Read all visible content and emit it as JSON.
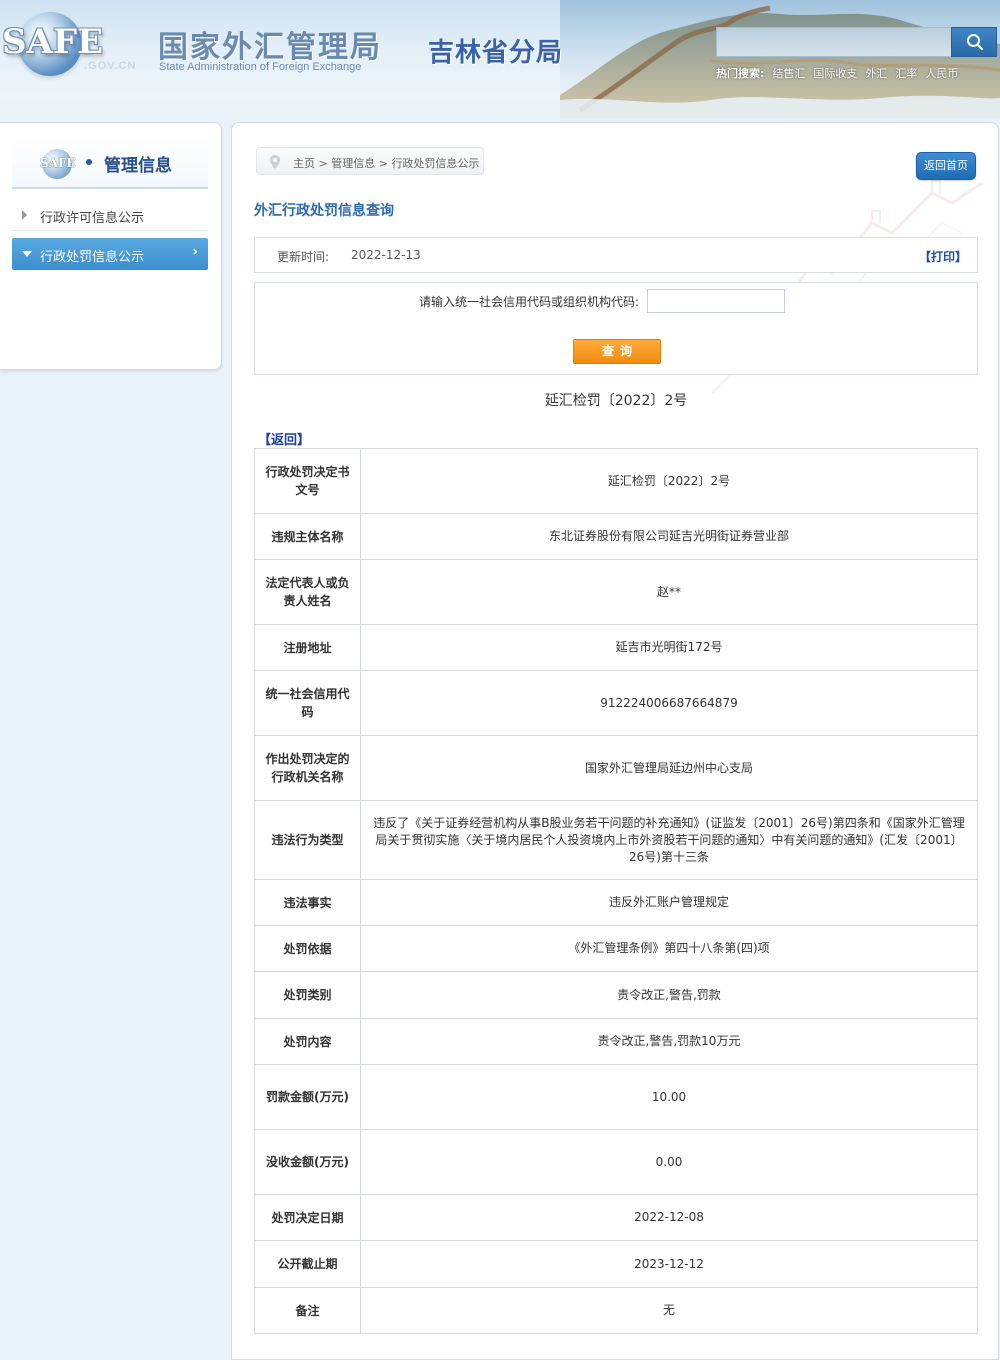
{
  "header": {
    "logo_text": "SAFE",
    "logo_domain": ".GOV.CN",
    "title_cn": "国家外汇管理局",
    "title_en": "State Administration of Foreign Exchange",
    "branch": "吉林省分局",
    "search_placeholder": "",
    "hot_search_label": "热门搜索:",
    "hot_links": [
      "结售汇",
      "国际收支",
      "外汇",
      "汇率",
      "人民币"
    ]
  },
  "sidebar": {
    "logo_text": "SAFE",
    "title": "管理信息",
    "items": [
      {
        "label": "行政许可信息公示",
        "active": false
      },
      {
        "label": "行政处罚信息公示",
        "active": true
      }
    ]
  },
  "breadcrumb": [
    "主页",
    "管理信息",
    "行政处罚信息公示"
  ],
  "breadcrumb_sep": " > ",
  "back_home_label": "返回首页",
  "section_title": "外汇行政处罚信息查询",
  "update": {
    "label": "更新时间:",
    "value": "2022-12-13",
    "print_label": "【打印】"
  },
  "query": {
    "label": "请输入统一社会信用代码或组织机构代码:",
    "input_value": "",
    "button_label": "查询"
  },
  "doc_number": "延汇检罚〔2022〕2号",
  "return_label": "【返回】",
  "details": [
    {
      "key": "行政处罚决定书文号",
      "value": "延汇检罚〔2022〕2号",
      "h": 65
    },
    {
      "key": "违规主体名称",
      "value": "东北证券股份有限公司延吉光明街证券营业部",
      "h": 46
    },
    {
      "key": "法定代表人或负责人姓名",
      "value": "赵**",
      "h": 65
    },
    {
      "key": "注册地址",
      "value": "延吉市光明街172号",
      "h": 46
    },
    {
      "key": "统一社会信用代码",
      "value": "912224006687664879",
      "h": 65
    },
    {
      "key": "作出处罚决定的行政机关名称",
      "value": "国家外汇管理局延边州中心支局",
      "h": 65
    },
    {
      "key": "违法行为类型",
      "value": "违反了《关于证券经营机构从事B股业务若干问题的补充通知》(证监发〔2001〕26号)第四条和《国家外汇管理局关于贯彻实施〈关于境内居民个人投资境内上市外资股若干问题的通知〉中有关问题的通知》(汇发〔2001〕26号)第十三条",
      "h": 79
    },
    {
      "key": "违法事实",
      "value": "违反外汇账户管理规定",
      "h": 46
    },
    {
      "key": "处罚依据",
      "value": "《外汇管理条例》第四十八条第(四)项",
      "h": 46
    },
    {
      "key": "处罚类别",
      "value": "责令改正,警告,罚款",
      "h": 47
    },
    {
      "key": "处罚内容",
      "value": "责令改正,警告,罚款10万元",
      "h": 46
    },
    {
      "key": "罚款金额(万元)",
      "value": "10.00",
      "h": 65
    },
    {
      "key": "没收金额(万元)",
      "value": "0.00",
      "h": 65
    },
    {
      "key": "处罚决定日期",
      "value": "2022-12-08",
      "h": 46
    },
    {
      "key": "公开截止期",
      "value": "2023-12-12",
      "h": 47
    },
    {
      "key": "备注",
      "value": "无",
      "h": 46
    }
  ]
}
